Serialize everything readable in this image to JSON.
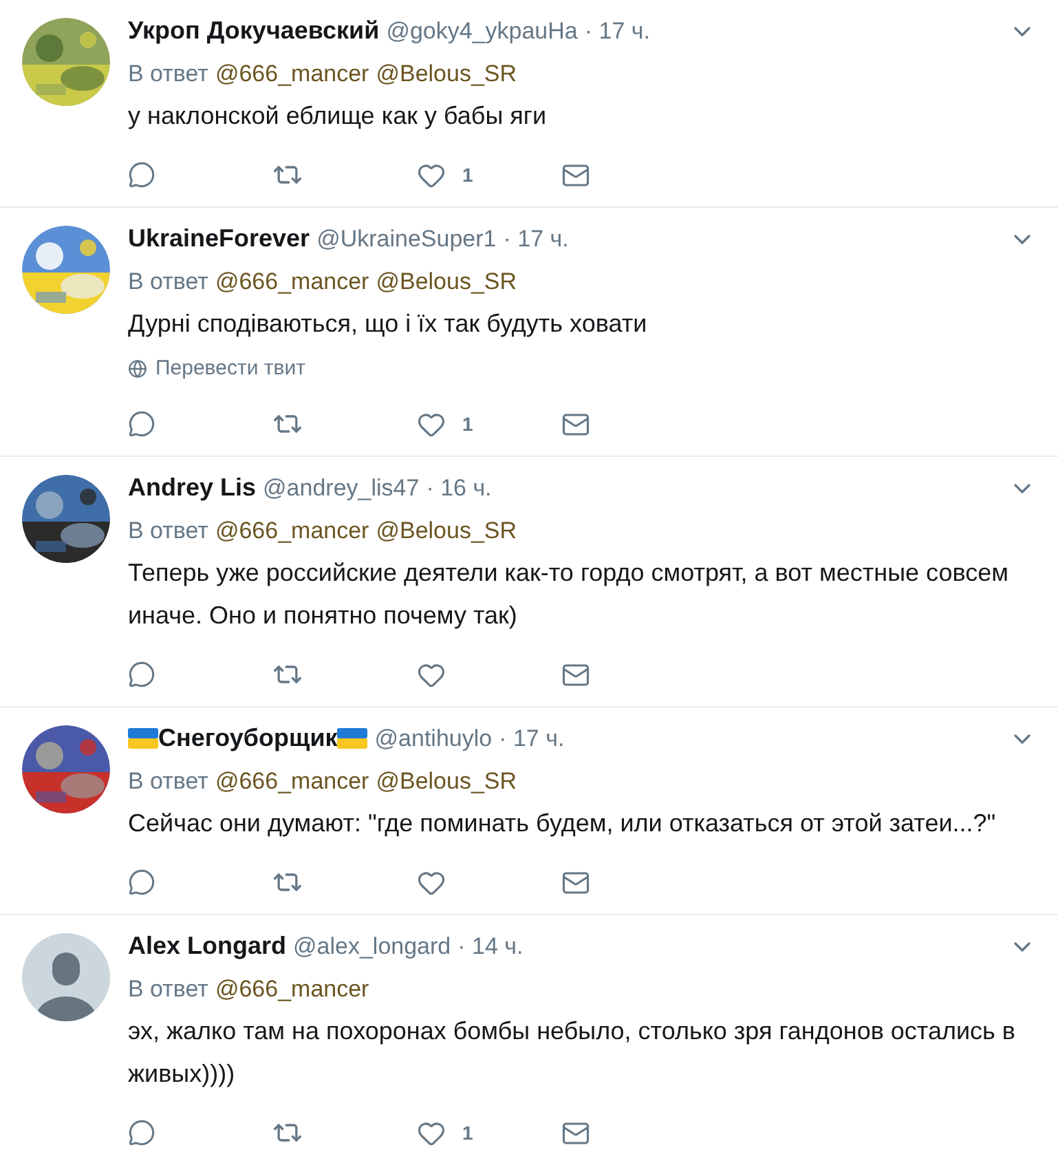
{
  "tweets": [
    {
      "kind": "picture",
      "name": "Укроп Докучаевский",
      "flags": false,
      "handle": "@goky4_ykpauHa",
      "time": "· 17 ч.",
      "reply_label": "В ответ",
      "mentions": [
        "@666_mancer",
        "@Belous_SR"
      ],
      "text": "у наклонской еблище как у бабы яги",
      "likes": "1"
    },
    {
      "kind": "picture",
      "name": "UkraineForever",
      "flags": false,
      "handle": "@UkraineSuper1",
      "time": "· 17 ч.",
      "reply_label": "В ответ",
      "mentions": [
        "@666_mancer",
        "@Belous_SR"
      ],
      "text": "Дурні сподіваються, що і їх так будуть ховати",
      "translate": "Перевести твит",
      "likes": "1"
    },
    {
      "kind": "picture",
      "name": "Andrey Lis",
      "flags": false,
      "handle": "@andrey_lis47",
      "time": "· 16 ч.",
      "reply_label": "В ответ",
      "mentions": [
        "@666_mancer",
        "@Belous_SR"
      ],
      "text": "Теперь уже российские деятели как-то гордо смотрят, а вот местные совсем иначе. Оно и понятно почему так)"
    },
    {
      "kind": "picture",
      "name": "Снегоуборщик",
      "flags": true,
      "handle": "@antihuylo",
      "time": "· 17 ч.",
      "reply_label": "В ответ",
      "mentions": [
        "@666_mancer",
        "@Belous_SR"
      ],
      "text": "Сейчас они думают: \"где поминать будем, или отказаться от этой затеи...?\""
    },
    {
      "kind": "default",
      "name": "Alex Longard",
      "flags": false,
      "handle": "@alex_longard",
      "time": "· 14 ч.",
      "reply_label": "В ответ",
      "mentions": [
        "@666_mancer"
      ],
      "text": "эх, жалко там на похоронах бомбы небыло, столько зря гандонов остались в живых))))",
      "likes": "1"
    }
  ]
}
